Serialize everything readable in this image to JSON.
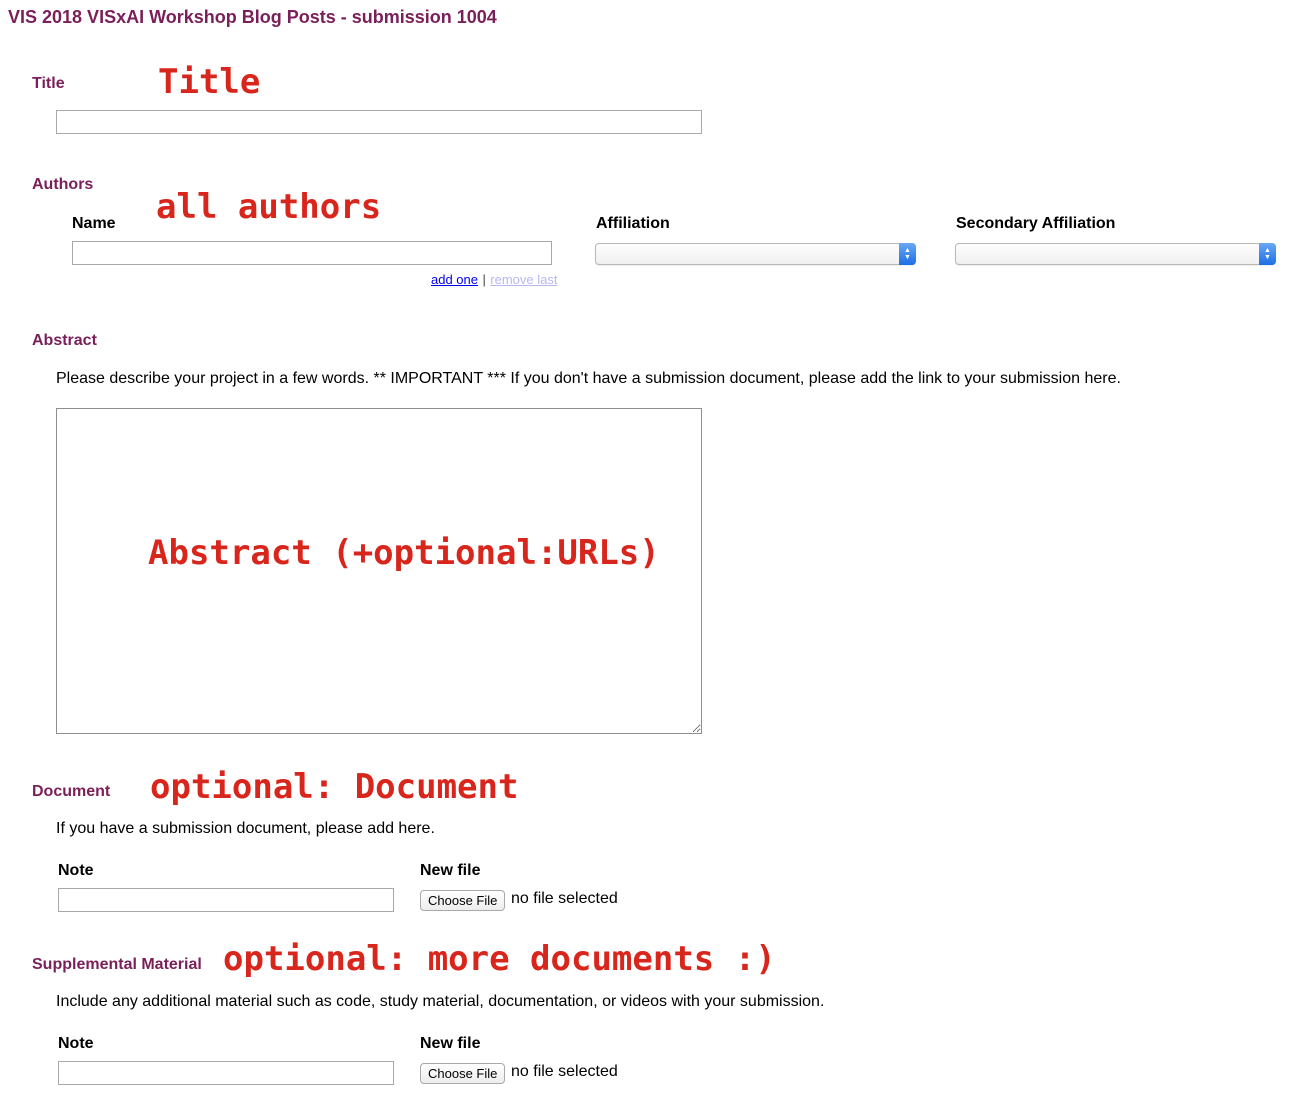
{
  "page": {
    "title": "VIS 2018 VISxAI Workshop Blog Posts - submission 1004"
  },
  "title_section": {
    "label": "Title",
    "annotation": "Title",
    "input_value": ""
  },
  "authors_section": {
    "label": "Authors",
    "annotation": "all authors",
    "name_label": "Name",
    "name_value": "",
    "affiliation_label": "Affiliation",
    "affiliation_value": "",
    "secondary_affiliation_label": "Secondary Affiliation",
    "secondary_affiliation_value": "",
    "add_one": "add one",
    "separator": "|",
    "remove_last": "remove last"
  },
  "abstract_section": {
    "label": "Abstract",
    "help": "Please describe your project in a few words. ** IMPORTANT *** If you don't have a submission document, please add the link to your submission here.",
    "annotation": "Abstract (+optional:URLs)",
    "value": ""
  },
  "document_section": {
    "label": "Document",
    "annotation": "optional: Document",
    "help": "If you have a submission document, please add here.",
    "note_label": "Note",
    "note_value": "",
    "new_file_label": "New file",
    "choose_file": "Choose File",
    "file_status": "no file selected"
  },
  "supplemental_section": {
    "label": "Supplemental Material",
    "annotation": "optional: more documents :)",
    "help": "Include any additional material such as code, study material, documentation, or videos with your submission.",
    "note_label": "Note",
    "note_value": "",
    "new_file_label": "New file",
    "choose_file": "Choose File",
    "file_status": "no file selected"
  },
  "colors": {
    "section_label": "#7a1f5a",
    "annotation": "#d8261c",
    "link": "#0000ee",
    "select_arrow": "#1e6ee6"
  },
  "icons": {
    "select_arrow": "up-down-chevron-icon"
  }
}
